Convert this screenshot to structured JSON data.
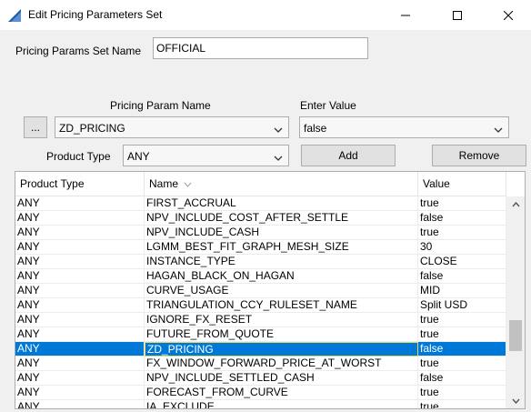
{
  "window": {
    "title": "Edit Pricing Parameters Set",
    "accent": "#1e5aa8",
    "minimize_icon": "minimize-icon",
    "maximize_icon": "maximize-icon",
    "close_icon": "close-icon"
  },
  "form": {
    "set_name_label": "Pricing Params Set Name",
    "set_name_value": "OFFICIAL",
    "param_name_label": "Pricing Param Name",
    "enter_value_label": "Enter Value",
    "ellipsis_label": "...",
    "param_name_selected": "ZD_PRICING",
    "enter_value_selected": "false",
    "product_type_label": "Product Type",
    "product_type_selected": "ANY",
    "add_label": "Add",
    "remove_label": "Remove"
  },
  "table": {
    "columns": [
      "Product Type",
      "Name",
      "Value"
    ],
    "sort_icon": "sort-indicator-icon",
    "rows": [
      {
        "product_type": "ANY",
        "name": "FIRST_ACCRUAL",
        "value": "true"
      },
      {
        "product_type": "ANY",
        "name": "NPV_INCLUDE_COST_AFTER_SETTLE",
        "value": "false"
      },
      {
        "product_type": "ANY",
        "name": "NPV_INCLUDE_CASH",
        "value": "true"
      },
      {
        "product_type": "ANY",
        "name": "LGMM_BEST_FIT_GRAPH_MESH_SIZE",
        "value": "30"
      },
      {
        "product_type": "ANY",
        "name": "INSTANCE_TYPE",
        "value": "CLOSE"
      },
      {
        "product_type": "ANY",
        "name": "HAGAN_BLACK_ON_HAGAN",
        "value": "false"
      },
      {
        "product_type": "ANY",
        "name": "CURVE_USAGE",
        "value": "MID"
      },
      {
        "product_type": "ANY",
        "name": "TRIANGULATION_CCY_RULESET_NAME",
        "value": "Split USD"
      },
      {
        "product_type": "ANY",
        "name": "IGNORE_FX_RESET",
        "value": "true"
      },
      {
        "product_type": "ANY",
        "name": "FUTURE_FROM_QUOTE",
        "value": "true"
      },
      {
        "product_type": "ANY",
        "name": "ZD_PRICING",
        "value": "false",
        "selected": true
      },
      {
        "product_type": "ANY",
        "name": "FX_WINDOW_FORWARD_PRICE_AT_WORST",
        "value": "true"
      },
      {
        "product_type": "ANY",
        "name": "NPV_INCLUDE_SETTLED_CASH",
        "value": "false"
      },
      {
        "product_type": "ANY",
        "name": "FORECAST_FROM_CURVE",
        "value": "true"
      },
      {
        "product_type": "ANY",
        "name": "IA_EXCLUDE",
        "value": "true"
      }
    ],
    "scroll_position": 0.72,
    "scroll_visible_fraction": 0.17
  }
}
